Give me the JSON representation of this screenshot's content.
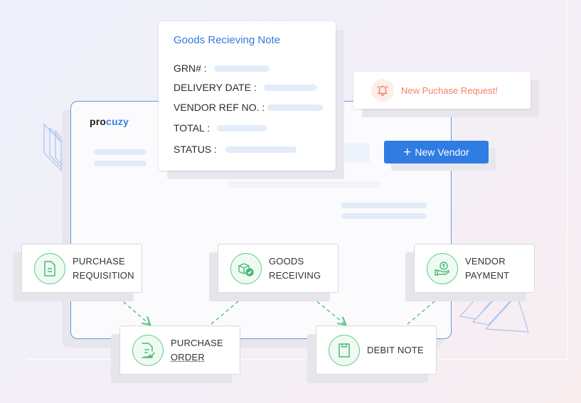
{
  "brand": {
    "logo_prefix": "pro",
    "logo_suffix": "cuzy"
  },
  "grn": {
    "title": "Goods Recieving Note",
    "fields": [
      {
        "label": "GRN# :"
      },
      {
        "label": "DELIVERY DATE :"
      },
      {
        "label": "VENDOR REF NO. :"
      },
      {
        "label": "TOTAL :"
      },
      {
        "label": "STATUS :"
      }
    ]
  },
  "notification": {
    "text": "New Puchase Request!",
    "icon": "bell-icon"
  },
  "vendor_button": {
    "plus": "+",
    "label": "New Vendor"
  },
  "workflow": {
    "purchase_requisition": {
      "line1": "PURCHASE",
      "line2": "REQUISITION",
      "icon": "document-icon"
    },
    "purchase_order": {
      "line1": "PURCHASE",
      "line2": "ORDER",
      "icon": "document-check-icon"
    },
    "goods_receiving": {
      "line1": "GOODS",
      "line2": "RECEIVING",
      "icon": "boxes-check-icon"
    },
    "debit_note": {
      "line1": "DEBIT NOTE",
      "icon": "note-icon"
    },
    "vendor_payment": {
      "line1": "VENDOR",
      "line2": "PAYMENT",
      "icon": "hand-coin-icon"
    }
  },
  "colors": {
    "accent_blue": "#2f7ce3",
    "title_blue": "#3679d6",
    "node_green": "#5fc98a",
    "notification_orange": "#f0826a",
    "skeleton": "#e3ecf9"
  }
}
